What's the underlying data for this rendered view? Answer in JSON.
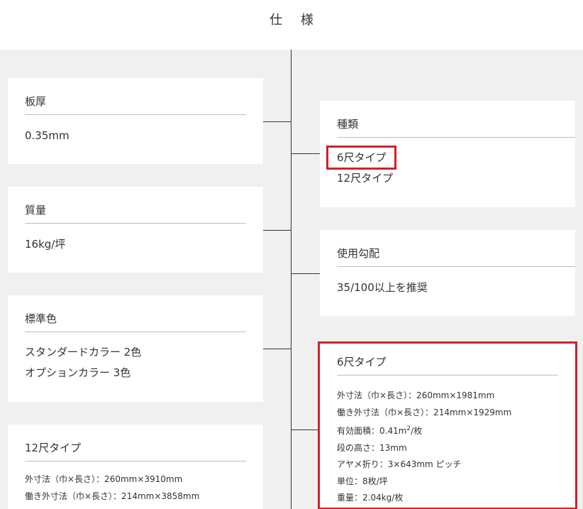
{
  "page": {
    "title": "仕 様"
  },
  "left_cards": {
    "thickness": {
      "title": "板厚",
      "value": "0.35mm"
    },
    "mass": {
      "title": "質量",
      "value": "16kg/坪"
    },
    "standard_color": {
      "title": "標準色",
      "lines": [
        "スタンダードカラー 2色",
        "オプションカラー 3色"
      ]
    },
    "type12": {
      "title": "12尺タイプ",
      "details": [
        "外寸法（巾×長さ）：260mm×3910mm",
        "働き外寸法（巾×長さ）：214mm×3858mm"
      ]
    }
  },
  "right_cards": {
    "kind": {
      "title": "種類",
      "options": [
        "6尺タイプ",
        "12尺タイプ"
      ]
    },
    "slope": {
      "title": "使用勾配",
      "value": "35/100以上を推奨"
    },
    "type6": {
      "title": "6尺タイプ",
      "details": {
        "outer": "外寸法（巾×長さ）：260mm×1981mm",
        "working": "働き外寸法（巾×長さ）：214mm×1929mm",
        "area_prefix": "有効面積：0.41m",
        "area_sup": "2",
        "area_suffix": "/枚",
        "step": "段の高さ：13mm",
        "fold": "アヤメ折り：3×643mm ピッチ",
        "unit": "単位：8枚/坪",
        "weight": "重量：2.04kg/枚"
      }
    }
  },
  "colors": {
    "highlight": "#d3202a",
    "background": "#f0f0f0",
    "line": "#333333"
  }
}
